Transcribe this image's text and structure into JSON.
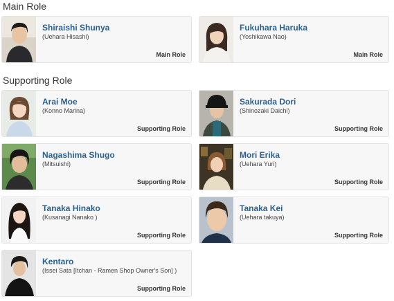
{
  "sections": {
    "main": {
      "title": "Main Role",
      "cast": [
        {
          "name": "Shiraishi Shunya",
          "character": "(Uehara Hisashi)",
          "role": "Main Role",
          "photo": "male-portrait"
        },
        {
          "name": "Fukuhara Haruka",
          "character": "(Yoshikawa Nao)",
          "role": "Main Role",
          "photo": "female-portrait"
        }
      ]
    },
    "supporting": {
      "title": "Supporting Role",
      "cast": [
        {
          "name": "Arai Moe",
          "character": "(Konno Marina)",
          "role": "Supporting Role",
          "photo": "female-portrait"
        },
        {
          "name": "Sakurada Dori",
          "character": "(Shinozaki Daichi)",
          "role": "Supporting Role",
          "photo": "male-portrait"
        },
        {
          "name": "Nagashima Shugo",
          "character": "(Mitsuishi)",
          "role": "Supporting Role",
          "photo": "male-portrait"
        },
        {
          "name": "Mori Erika",
          "character": "(Uehara Yuri)",
          "role": "Supporting Role",
          "photo": "female-portrait"
        },
        {
          "name": "Tanaka Hinako",
          "character": "(Kusanagi Nanako )",
          "role": "Supporting Role",
          "photo": "female-portrait"
        },
        {
          "name": "Tanaka Kei",
          "character": "(Uehara takuya)",
          "role": "Supporting Role",
          "photo": "male-portrait"
        },
        {
          "name": "Kentaro",
          "character": "(Issei Sata [Itchan - Ramen Shop Owner's Son] )",
          "role": "Supporting Role",
          "photo": "male-portrait"
        }
      ]
    }
  },
  "colors": {
    "accent_name": "#2b5f8e",
    "card_bg": "#f7f7f7",
    "card_border": "#e3e3e3"
  }
}
